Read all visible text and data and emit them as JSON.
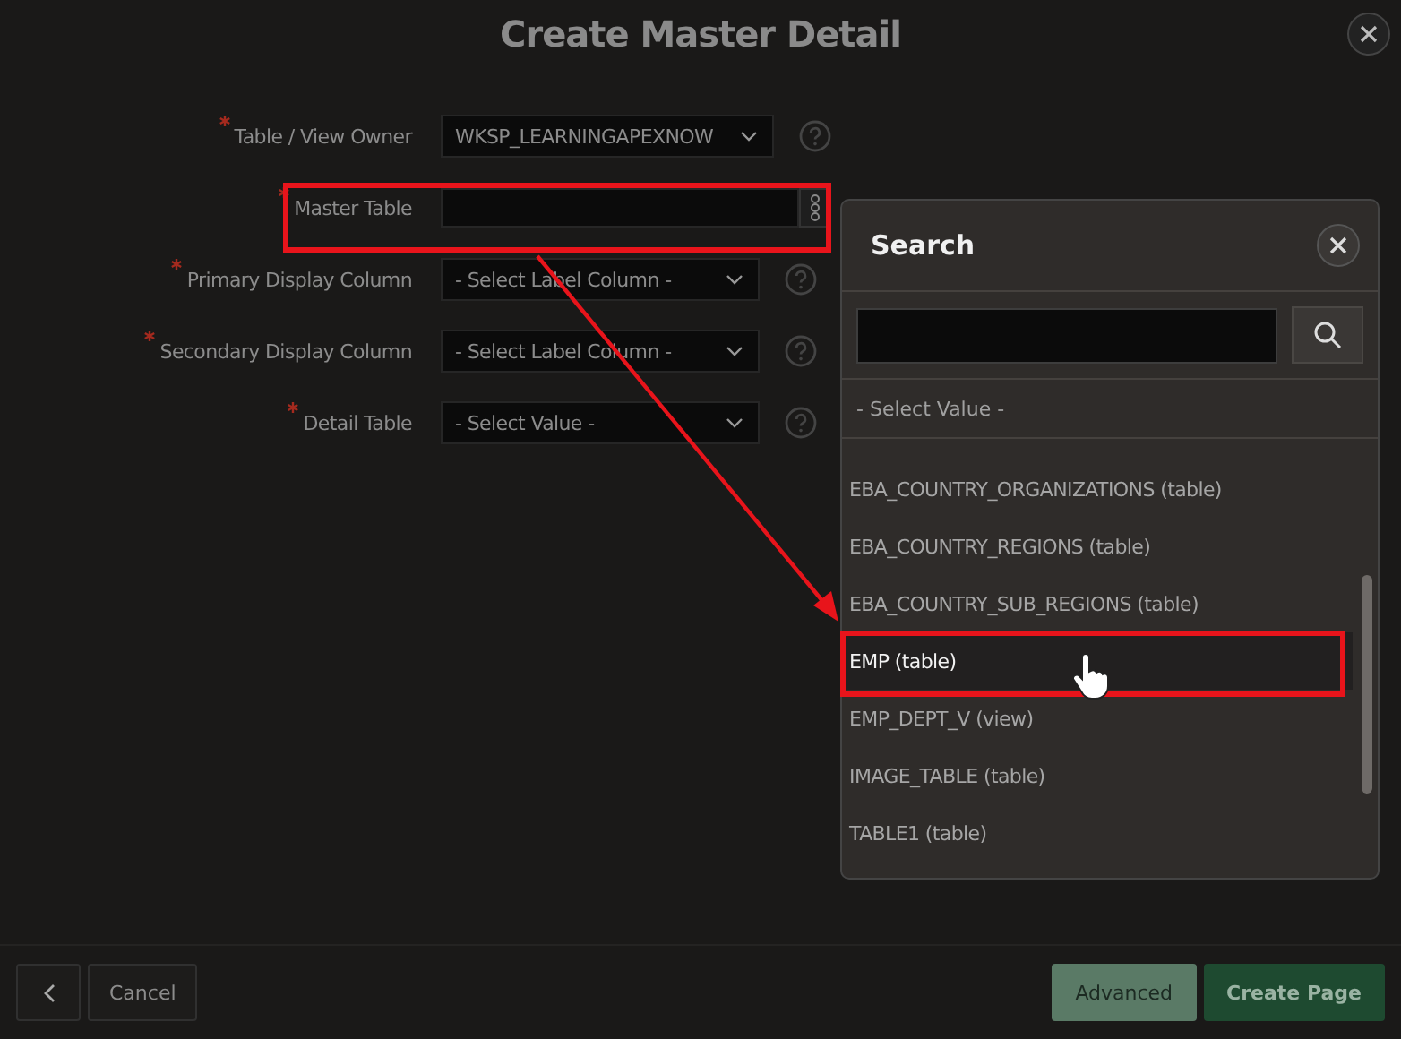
{
  "dialog": {
    "title": "Create Master Detail"
  },
  "fields": [
    {
      "label": "Table / View Owner",
      "required": true,
      "kind": "select",
      "value": "WKSP_LEARNINGAPEXNOW",
      "help": true
    },
    {
      "label": "Master Table",
      "required": true,
      "kind": "popup",
      "help": false
    },
    {
      "label": "Primary Display Column",
      "required": true,
      "kind": "select",
      "value": "- Select Label Column -",
      "help": true
    },
    {
      "label": "Secondary Display Column",
      "required": true,
      "kind": "select",
      "value": "- Select Label Column -",
      "help": true
    },
    {
      "label": "Detail Table",
      "required": true,
      "kind": "select",
      "value": "- Select Value -",
      "help": true
    }
  ],
  "popup": {
    "title": "Search",
    "null_option": "- Select Value -",
    "items": [
      {
        "label": "EBA_COUNTRY_ORGANIZATIONS (table)",
        "selected": false
      },
      {
        "label": "EBA_COUNTRY_REGIONS (table)",
        "selected": false
      },
      {
        "label": "EBA_COUNTRY_SUB_REGIONS (table)",
        "selected": false
      },
      {
        "label": "EMP (table)",
        "selected": true
      },
      {
        "label": "EMP_DEPT_V (view)",
        "selected": false
      },
      {
        "label": "IMAGE_TABLE (table)",
        "selected": false
      },
      {
        "label": "TABLE1 (table)",
        "selected": false
      }
    ]
  },
  "footer": {
    "cancel": "Cancel",
    "advanced": "Advanced",
    "create": "Create Page"
  }
}
